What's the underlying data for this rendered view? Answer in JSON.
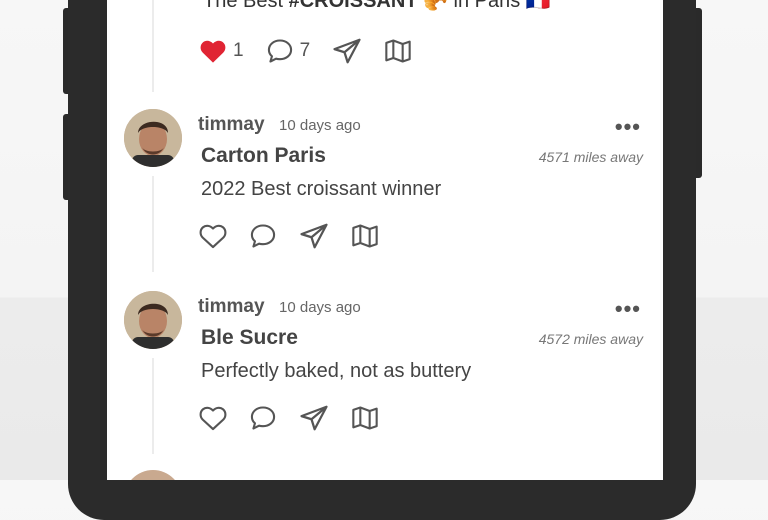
{
  "top_post": {
    "text_prefix": "The Best ",
    "hashtag": "#CROISSANT",
    "croissant_emoji": "🥐",
    "text_suffix": " in Paris ",
    "flag_emoji": "🇫🇷",
    "likes": "1",
    "comments": "7",
    "liked": true
  },
  "comments": [
    {
      "username": "timmay",
      "time": "10 days ago",
      "more": "•••",
      "place": "Carton Paris",
      "distance": "4571 miles away",
      "text": "2022 Best croissant winner"
    },
    {
      "username": "timmay",
      "time": "10 days ago",
      "more": "•••",
      "place": "Ble Sucre",
      "distance": "4572 miles away",
      "text": "Perfectly baked, not as buttery"
    }
  ],
  "icons": {
    "like": "heart-icon",
    "comment": "comment-bubble-icon",
    "share": "send-icon",
    "map": "map-icon"
  },
  "colors": {
    "like_active": "#e02433",
    "icon": "#555555",
    "phone_frame": "#2b2b2b"
  }
}
